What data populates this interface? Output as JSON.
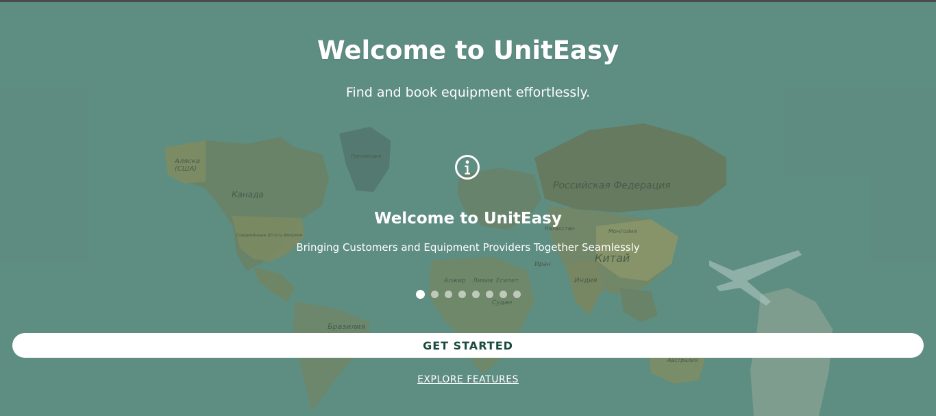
{
  "hero": {
    "title": "Welcome to UnitEasy",
    "subtitle": "Find and book equipment effortlessly."
  },
  "carousel": {
    "icon": "info-circle-icon",
    "slide_title": "Welcome to UnitEasy",
    "slide_text": "Bringing Customers and Equipment Providers Together Seamlessly",
    "slide_count": 8,
    "active_index": 0
  },
  "actions": {
    "get_started_label": "GET STARTED",
    "explore_label": "EXPLORE FEATURES"
  },
  "background": {
    "map_labels": {
      "alaska": "Аляска",
      "usa_short": "(США)",
      "canada": "Канада",
      "greenland": "Гренландия",
      "usa": "Соединённые Штаты Америки",
      "russia": "Российская Федерация",
      "kazakhstan": "Казахстан",
      "mongolia": "Монголия",
      "china": "Китай",
      "iran": "Иран",
      "india": "Индия",
      "algeria": "Алжир",
      "libya": "Ливия",
      "egypt": "Египет",
      "sudan": "Судан",
      "brazil": "Бразилия",
      "australia": "Австралия"
    }
  },
  "colors": {
    "overlay": "#5f8a80",
    "button_bg": "#ffffff",
    "button_text": "#1a4a3e"
  }
}
